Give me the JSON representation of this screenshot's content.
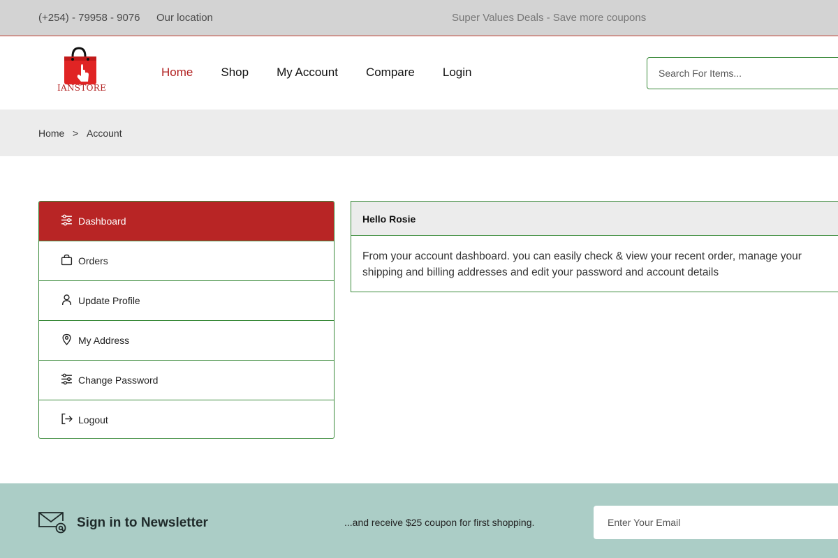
{
  "topbar": {
    "phone": "(+254) - 79958 - 9076",
    "location": "Our location",
    "promo": "Super Values Deals - Save more coupons"
  },
  "header": {
    "logo_text": "IANSTORE",
    "nav": [
      "Home",
      "Shop",
      "My Account",
      "Compare",
      "Login"
    ],
    "active_nav": "Home",
    "search_placeholder": "Search For Items..."
  },
  "breadcrumb": {
    "home": "Home",
    "separator": ">",
    "current": "Account"
  },
  "sidebar": {
    "items": [
      {
        "label": "Dashboard",
        "icon": "sliders-icon"
      },
      {
        "label": "Orders",
        "icon": "shopping-bag-icon"
      },
      {
        "label": "Update Profile",
        "icon": "user-icon"
      },
      {
        "label": "My Address",
        "icon": "map-pin-icon"
      },
      {
        "label": "Change Password",
        "icon": "sliders-icon"
      },
      {
        "label": "Logout",
        "icon": "logout-icon"
      }
    ],
    "active": "Dashboard"
  },
  "content": {
    "greeting": "Hello Rosie",
    "body": "From your account dashboard. you can easily check & view your recent order, manage your shipping and billing addresses and edit your password and account details"
  },
  "newsletter": {
    "title": "Sign in to Newsletter",
    "subtitle": "...and receive $25 coupon for first shopping.",
    "email_placeholder": "Enter Your Email"
  },
  "colors": {
    "accent": "#b82525",
    "border": "#3a8a3a",
    "newsletter_bg": "#abcdc6",
    "topbar_bg": "#d3d3d3"
  }
}
